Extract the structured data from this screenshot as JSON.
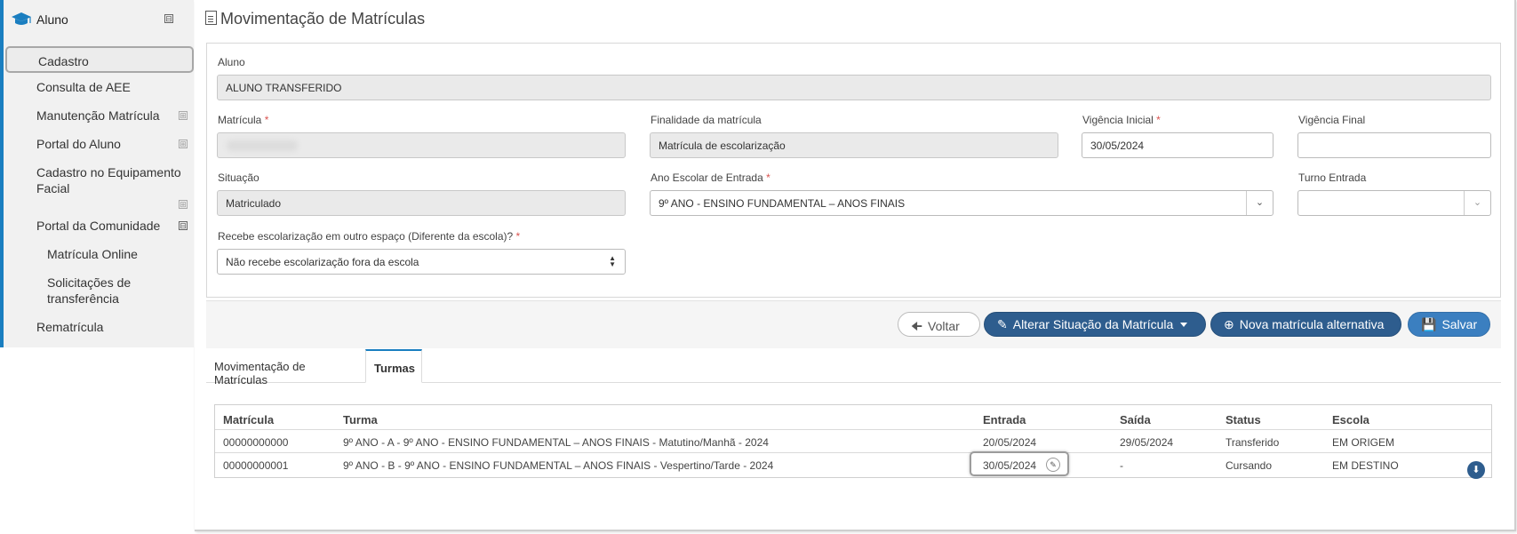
{
  "sidebar": {
    "title": "Aluno",
    "toggle_minus": "⊟",
    "toggle_plus": "⊞",
    "items": [
      {
        "label": "Cadastro"
      },
      {
        "label": "Consulta de AEE"
      },
      {
        "label": "Manutenção Matrícula"
      },
      {
        "label": "Portal do Aluno"
      },
      {
        "label": "Cadastro no Equipamento Facial"
      },
      {
        "label": "Portal da Comunidade"
      },
      {
        "label": "Matrícula Online"
      },
      {
        "label": "Solicitações de transferência"
      },
      {
        "label": "Rematrícula"
      }
    ]
  },
  "page": {
    "title": "Movimentação de Matrículas"
  },
  "form": {
    "aluno": {
      "label": "Aluno",
      "value": "ALUNO TRANSFERIDO"
    },
    "matricula": {
      "label": "Matrícula",
      "required": "*"
    },
    "finalidade": {
      "label": "Finalidade da matrícula",
      "value": "Matrícula de escolarização"
    },
    "vigencia_inicial": {
      "label": "Vigência Inicial",
      "required": "*",
      "value": "30/05/2024"
    },
    "vigencia_final": {
      "label": "Vigência Final",
      "value": ""
    },
    "situacao": {
      "label": "Situação",
      "value": "Matriculado"
    },
    "ano_escolar": {
      "label": "Ano Escolar de Entrada",
      "required": "*",
      "value": "9º ANO - ENSINO FUNDAMENTAL – ANOS FINAIS"
    },
    "turno": {
      "label": "Turno Entrada",
      "value": ""
    },
    "recebe": {
      "label": "Recebe escolarização em outro espaço (Diferente da escola)?",
      "required": "*",
      "value": "Não recebe escolarização fora da escola"
    }
  },
  "actions": {
    "voltar": "Voltar",
    "alterar": "Alterar Situação da Matrícula",
    "nova": "Nova matrícula alternativa",
    "salvar": "Salvar"
  },
  "tabs": [
    {
      "label": "Movimentação de Matrículas",
      "active": false
    },
    {
      "label": "Turmas",
      "active": true
    }
  ],
  "table": {
    "headers": [
      "Matrícula",
      "Turma",
      "Entrada",
      "Saída",
      "Status",
      "Escola"
    ],
    "rows": [
      [
        "00000000000",
        "9º ANO - A - 9º ANO - ENSINO FUNDAMENTAL – ANOS FINAIS - Matutino/Manhã - 2024",
        "20/05/2024",
        "29/05/2024",
        "Transferido",
        "EM ORIGEM"
      ],
      [
        "00000000001",
        "9º ANO - B - 9º ANO - ENSINO FUNDAMENTAL – ANOS FINAIS - Vespertino/Tarde - 2024",
        "30/05/2024",
        "-",
        "Cursando",
        "EM DESTINO"
      ]
    ]
  },
  "colors": {
    "accent": "#1a7ec0",
    "primary_button": "#2e5d8e",
    "required": "#d9534f"
  },
  "icons": [
    "graduation-cap-icon",
    "document-icon",
    "arrow-left-icon",
    "edit-icon",
    "plus-circle-icon",
    "save-icon",
    "download-icon",
    "chevron-down-icon"
  ]
}
